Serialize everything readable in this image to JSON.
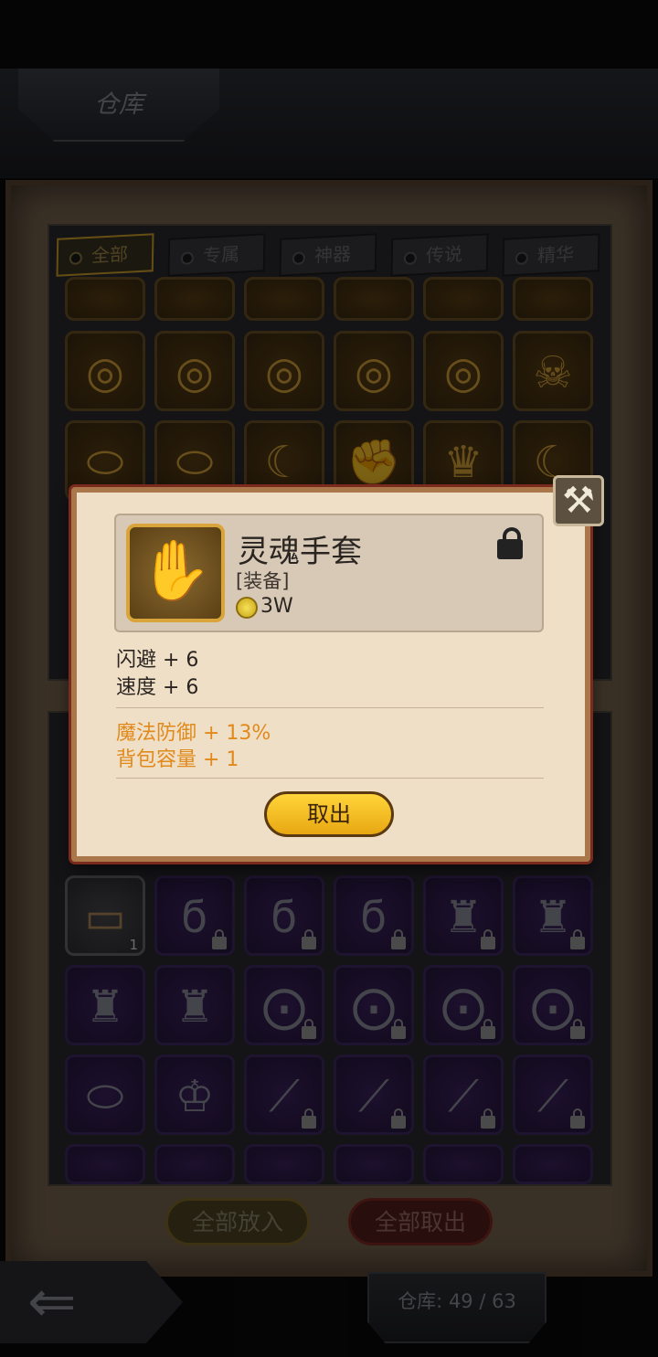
{
  "header": {
    "title": "仓库"
  },
  "tabs": [
    "全部",
    "专属",
    "神器",
    "传说",
    "精华"
  ],
  "grid_top_rows": [
    [
      "⚔",
      "⚔",
      "⚔",
      "⚔",
      "⚔",
      "⚔"
    ],
    [
      "◎",
      "◎",
      "◎",
      "◎",
      "◎",
      "☠"
    ],
    [
      "⬭",
      "⬭",
      "☾",
      "✊",
      "♛",
      "☾"
    ]
  ],
  "grid_bottom_rows": [
    [
      "▭",
      "ϭ",
      "ϭ",
      "ϭ",
      "♜",
      "♜"
    ],
    [
      "♜",
      "♜",
      "⨀",
      "⨀",
      "⨀",
      "⨀"
    ],
    [
      "⬭",
      "♔",
      "⟋",
      "⟋",
      "⟋",
      "⟋"
    ],
    [
      "✶",
      "✶",
      "☗",
      "☗",
      "☗",
      "☗"
    ]
  ],
  "chest_count": "1",
  "popup": {
    "item_name": "灵魂手套",
    "item_type": "[装备]",
    "price": "3W",
    "stats": [
      "闪避 + 6",
      "速度 + 6"
    ],
    "bonus_stats": [
      "魔法防御 + 13%",
      "背包容量 + 1"
    ],
    "confirm_label": "取出",
    "close_icon_glyph": "⚒"
  },
  "bottom": {
    "put_all_label": "全部放入",
    "take_all_label": "全部取出",
    "capacity": "仓库: 49 / 63",
    "back_glyph": "⇐"
  }
}
